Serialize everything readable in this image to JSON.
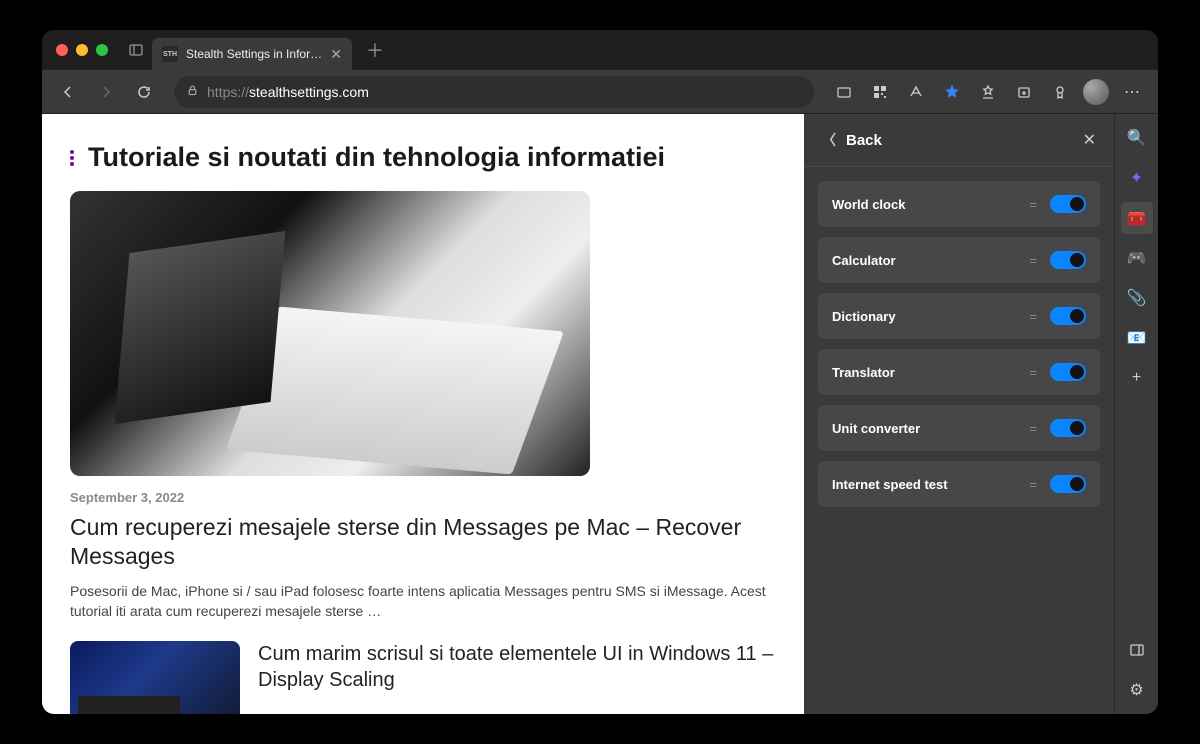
{
  "tab": {
    "title": "Stealth Settings in Information",
    "favicon_text": "STH"
  },
  "url": {
    "protocol": "https://",
    "domain": "stealthsettings.com"
  },
  "page": {
    "heading": "Tutoriale si noutati din tehnologia informatiei",
    "post1": {
      "date": "September 3, 2022",
      "title": "Cum recuperezi mesajele sterse din Messages pe Mac – Recover Messages",
      "excerpt": "Posesorii de Mac, iPhone si / sau iPad folosesc foarte intens aplicatia Messages pentru SMS si iMessage. Acest tutorial iti arata cum recuperezi mesajele sterse …"
    },
    "post2": {
      "title": "Cum marim scrisul si toate elementele UI in Windows 11 – Display Scaling"
    }
  },
  "sidebar": {
    "back": "Back",
    "tools": [
      {
        "name": "World clock",
        "on": true
      },
      {
        "name": "Calculator",
        "on": true
      },
      {
        "name": "Dictionary",
        "on": true
      },
      {
        "name": "Translator",
        "on": true
      },
      {
        "name": "Unit converter",
        "on": true
      },
      {
        "name": "Internet speed test",
        "on": true
      }
    ]
  },
  "rail": {
    "search": "🔍",
    "copilot": "✦",
    "tools": "🧰",
    "games": "🎮",
    "office": "📎",
    "outlook": "📧",
    "plus": "+",
    "collapse": "⇥",
    "settings": "⚙"
  }
}
